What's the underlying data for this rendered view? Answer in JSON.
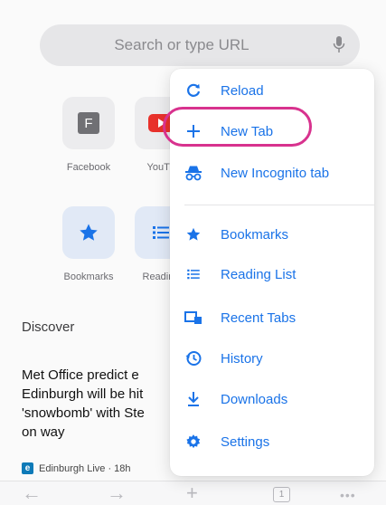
{
  "search": {
    "placeholder": "Search or type URL"
  },
  "shortcuts": [
    {
      "label": "Facebook",
      "glyph": "F",
      "icon": "facebook-icon"
    },
    {
      "label": "YouTu",
      "icon": "youtube-icon"
    },
    {
      "label": "Bookmarks",
      "icon": "star-icon"
    },
    {
      "label": "Reading",
      "icon": "list-icon"
    }
  ],
  "feed": {
    "heading": "Discover",
    "article_title": "Met Office predict e… Edinburgh will be hit 'snowbomb' with St… on way",
    "article_lines": [
      "Met Office predict e",
      "Edinburgh will be hit",
      "'snowbomb' with Ste",
      "on way"
    ],
    "source_logo": "e",
    "source": "Edinburgh Live · 18h"
  },
  "toolbar": {
    "tab_count": "1",
    "icons": [
      "back-icon",
      "forward-icon",
      "new-tab-icon",
      "tab-switcher-icon",
      "more-icon"
    ]
  },
  "menu": {
    "items": [
      {
        "label": "Reload",
        "icon": "reload-icon"
      },
      {
        "label": "New Tab",
        "icon": "plus-icon",
        "highlighted": true
      },
      {
        "label": "New Incognito tab",
        "icon": "incognito-icon"
      },
      {
        "label": "Bookmarks",
        "icon": "star-icon"
      },
      {
        "label": "Reading List",
        "icon": "list-icon"
      },
      {
        "label": "Recent Tabs",
        "icon": "recent-tabs-icon"
      },
      {
        "label": "History",
        "icon": "history-icon"
      },
      {
        "label": "Downloads",
        "icon": "download-icon"
      },
      {
        "label": "Settings",
        "icon": "settings-icon"
      }
    ]
  },
  "colors": {
    "accent": "#1a73e8",
    "highlight_ring": "#d8328e",
    "youtube": "#e8312b"
  }
}
